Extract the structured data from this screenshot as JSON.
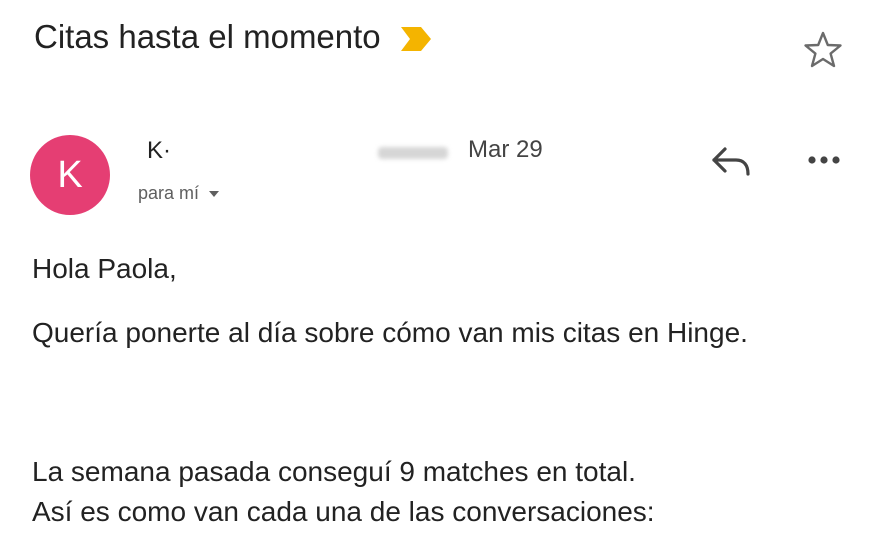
{
  "email": {
    "subject": "Citas hasta el momento",
    "sender_initial": "K",
    "sender_name": "K·",
    "date": "Mar 29",
    "recipient_label": "para mí",
    "greeting": "Hola Paola,",
    "paragraph1": "Quería ponerte al día sobre cómo van mis citas en Hinge.",
    "paragraph2_line1": "La semana pasada conseguí 9 matches en total.",
    "paragraph2_line2": "Así es como van cada una de las conversaciones:"
  },
  "icons": {
    "importance": "importance-marker-icon",
    "star": "star-icon",
    "reply": "reply-icon",
    "more": "more-options-icon",
    "caret": "caret-down-icon"
  },
  "colors": {
    "avatar": "#e53e73",
    "importance": "#f4b400",
    "text": "#222222",
    "secondary": "#5f5f5f"
  }
}
